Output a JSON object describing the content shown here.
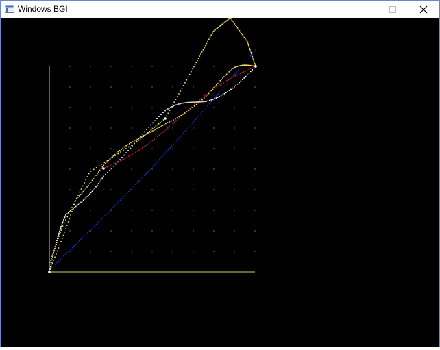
{
  "window": {
    "title": "Windows BGI",
    "icon": "app-window-icon",
    "controls": [
      "minimize-icon",
      "maximize-icon",
      "close-icon"
    ]
  },
  "canvas": {
    "background": "#000000",
    "colors": {
      "axis": "#d8d060",
      "grid_dots": "#c8c8c8",
      "white_curve": "#ffffff",
      "yellow_curve": "#f0e060",
      "blue_line": "#2030c0",
      "red_line": "#c02020"
    }
  }
}
